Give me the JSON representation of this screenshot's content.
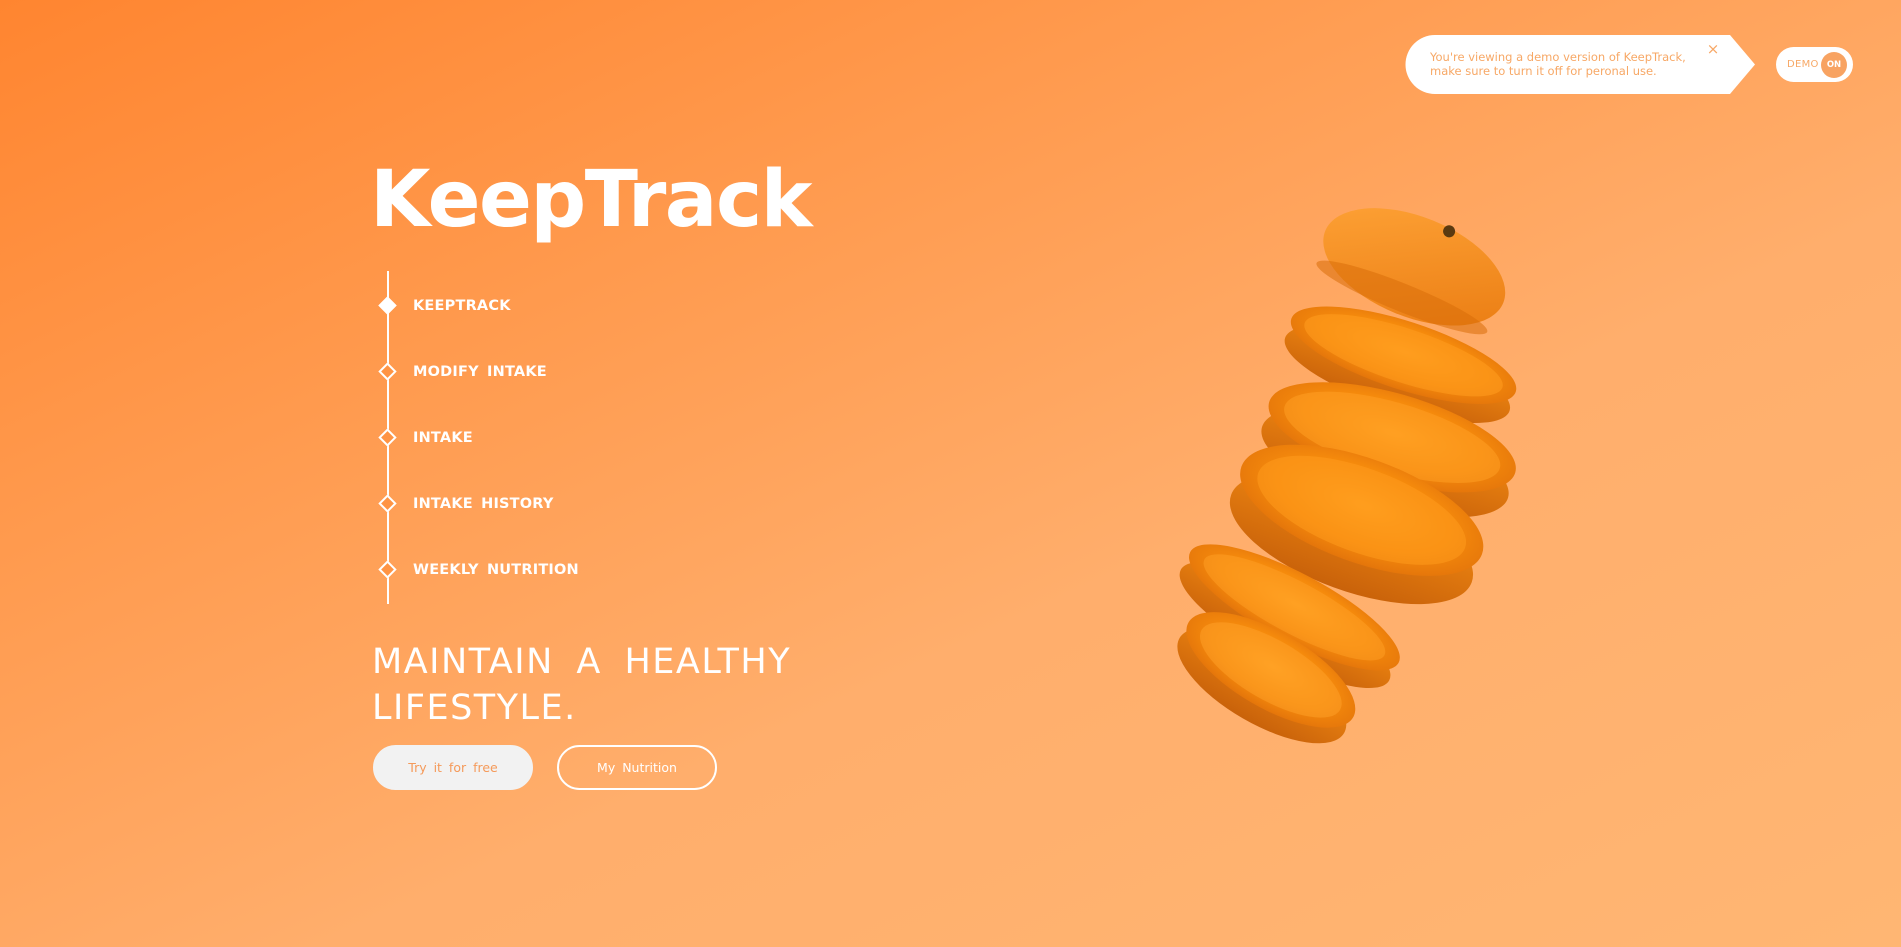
{
  "app": {
    "title": "KeepTrack"
  },
  "demo_notice": {
    "message": "You're viewing a demo version of KeepTrack, make sure to turn it off for peronal use.",
    "close_icon": "close-icon",
    "close_glyph": "×"
  },
  "demo_toggle": {
    "label": "DEMO",
    "state_label": "ON",
    "state": "on"
  },
  "nav": {
    "items": [
      {
        "label": "KEEPTRACK",
        "active": true
      },
      {
        "label": "MODIFY  INTAKE",
        "active": false
      },
      {
        "label": "INTAKE",
        "active": false
      },
      {
        "label": "INTAKE  HISTORY",
        "active": false
      },
      {
        "label": "WEEKLY  NUTRITION",
        "active": false
      }
    ]
  },
  "hero": {
    "tagline_line1": "MAINTAIN  A  HEALTHY",
    "tagline_line2": "LIFESTYLE.",
    "primary_button": "Try  it  for  free",
    "secondary_button": "My  Nutrition"
  },
  "illustration": {
    "icon": "sliced-orange-image"
  },
  "colors": {
    "gradient_start": "#ff8530",
    "gradient_end": "#ffb673",
    "accent_text": "#f7a866",
    "white": "#ffffff",
    "primary_button_bg": "#f2f2f2"
  }
}
